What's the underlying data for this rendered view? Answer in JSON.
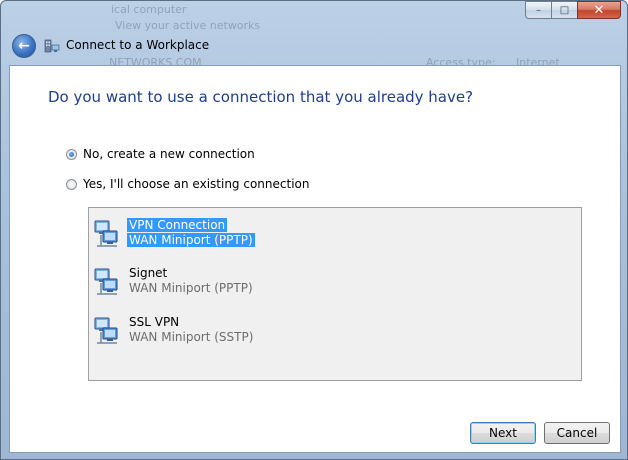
{
  "window": {
    "title": "Connect to a Workplace",
    "background_ghost_text": [
      "ical computer",
      "View your active networks",
      "NETWORKS.COM",
      "Access type:",
      "Internet"
    ]
  },
  "caption_buttons": {
    "minimize": "–",
    "maximize": "□",
    "close": "✕"
  },
  "page": {
    "heading": "Do you want to use a connection that you already have?"
  },
  "options": [
    {
      "label": "No, create a new connection",
      "checked": true
    },
    {
      "label": "Yes, I'll choose an existing connection",
      "checked": false
    }
  ],
  "connections": [
    {
      "name": "VPN Connection",
      "type": "WAN Miniport (PPTP)",
      "selected": true
    },
    {
      "name": "Signet",
      "type": "WAN Miniport (PPTP)",
      "selected": false
    },
    {
      "name": "SSL VPN",
      "type": "WAN Miniport (SSTP)",
      "selected": false
    }
  ],
  "buttons": {
    "next": "Next",
    "cancel": "Cancel"
  },
  "colors": {
    "heading": "#1e3e8c",
    "selection": "#3399ff",
    "list_background": "#f0f0f0"
  }
}
